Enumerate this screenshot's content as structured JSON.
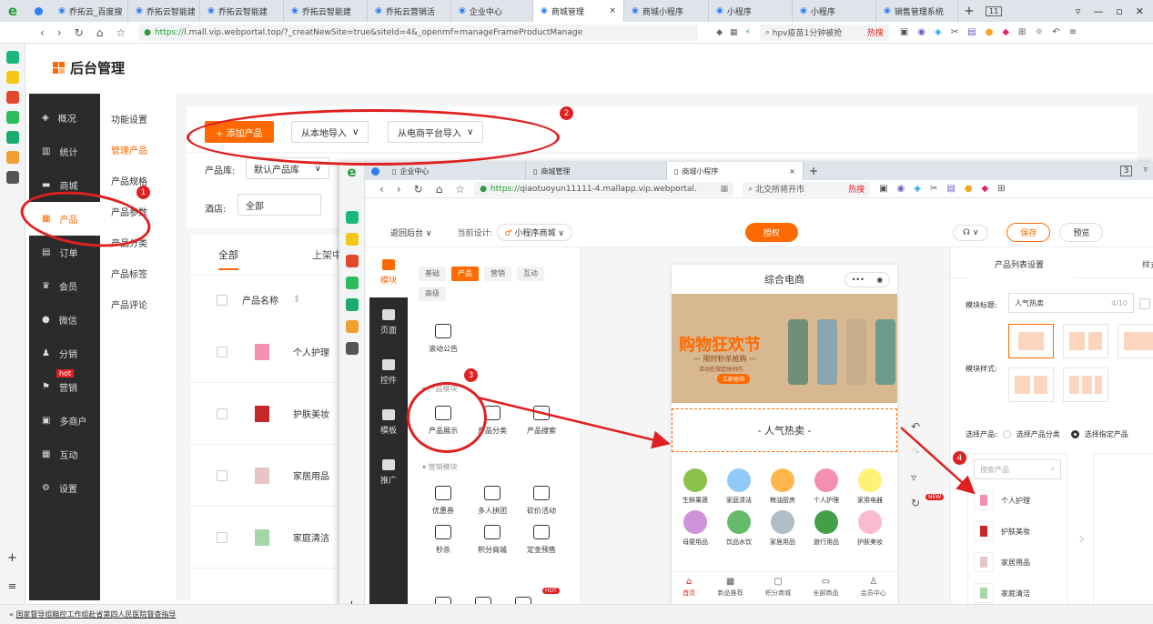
{
  "browser": {
    "tabs": [
      {
        "label": "乔拓云_百度搜"
      },
      {
        "label": "乔拓云智能建"
      },
      {
        "label": "乔拓云智能建"
      },
      {
        "label": "乔拓云智能建"
      },
      {
        "label": "乔拓云营销活"
      },
      {
        "label": "企业中心"
      },
      {
        "label": "商城管理",
        "active": true
      },
      {
        "label": "商城小程序"
      },
      {
        "label": "小程序"
      },
      {
        "label": "小程序"
      },
      {
        "label": "销售管理系统"
      }
    ],
    "tab_count": "11",
    "url_secure": "https://",
    "url": "l.mall.vip.webportal.top/?_creatNewSite=true&siteId=4&_openmf=manageFrameProductManage",
    "search_text": "hpv疫苗1分钟被抢",
    "hot_label": "热搜"
  },
  "app": {
    "title": "后台管理"
  },
  "sidebar": [
    {
      "label": "概况"
    },
    {
      "label": "统计"
    },
    {
      "label": "商城"
    },
    {
      "label": "产品",
      "active": true
    },
    {
      "label": "订单"
    },
    {
      "label": "会员"
    },
    {
      "label": "微信"
    },
    {
      "label": "分销"
    },
    {
      "label": "营销",
      "badge": "hot"
    },
    {
      "label": "多商户"
    },
    {
      "label": "互动"
    },
    {
      "label": "设置"
    }
  ],
  "submenu": [
    {
      "label": "功能设置"
    },
    {
      "label": "管理产品",
      "active": true
    },
    {
      "label": "产品规格"
    },
    {
      "label": "产品参数"
    },
    {
      "label": "产品分类"
    },
    {
      "label": "产品标签"
    },
    {
      "label": "产品评论"
    }
  ],
  "main": {
    "add_product": "+  添加产品",
    "import_local": "从本地导入",
    "import_ecom": "从电商平台导入",
    "lib_label": "产品库:",
    "lib_value": "默认产品库",
    "hotel_label": "酒店:",
    "hotel_value": "全部",
    "tab_all": "全部",
    "tab_onsale": "上架中",
    "col_name": "产品名称",
    "rows": [
      {
        "name": "个人护理"
      },
      {
        "name": "护肤美妆"
      },
      {
        "name": "家居用品"
      },
      {
        "name": "家庭清洁"
      }
    ]
  },
  "popup": {
    "tabs": [
      {
        "label": "企业中心"
      },
      {
        "label": "商城管理"
      },
      {
        "label": "商城小程序",
        "active": true
      }
    ],
    "url_secure": "https://",
    "url": "qiaotuoyun11111-4.mallapp.vip.webportal.",
    "search_text": "北交所将开市",
    "hot_label": "热搜",
    "tab_count": "3",
    "back_label": "返回后台",
    "current_design_label": "当前设计:",
    "current_design_value": "小程序商城",
    "authorize": "授权",
    "save": "保存",
    "preview": "预览",
    "vtabs": [
      {
        "label": "模块",
        "active": true
      },
      {
        "label": "页面"
      },
      {
        "label": "控件"
      },
      {
        "label": "模板"
      },
      {
        "label": "推广"
      }
    ],
    "widget_cats": [
      {
        "label": "基础"
      },
      {
        "label": "产品",
        "active": true
      },
      {
        "label": "营销"
      },
      {
        "label": "互动"
      },
      {
        "label": "高级"
      }
    ],
    "scroll_notice": "滚动公告",
    "product_module_title": "产品模块",
    "product_widgets": [
      {
        "label": "产品展示"
      },
      {
        "label": "产品分类"
      },
      {
        "label": "产品搜索"
      }
    ],
    "marketing_module_title": "营销模块",
    "marketing_widgets": [
      {
        "label": "优惠券"
      },
      {
        "label": "多人拼团"
      },
      {
        "label": "砍价活动"
      },
      {
        "label": "秒杀"
      },
      {
        "label": "积分商城"
      },
      {
        "label": "定金预售"
      }
    ],
    "hot_tag": "HOT",
    "new_tag": "NEW",
    "phone": {
      "title": "综合电商",
      "banner_title": "购物狂欢节",
      "banner_sub": "— 限时秒杀抢购 —",
      "banner_small": "活动在规定时间内",
      "banner_btn": "立即抢购",
      "section_title": "- 人气热卖 -",
      "categories": [
        {
          "label": "生鲜果蔬",
          "color": "#8bc34a"
        },
        {
          "label": "家庭清洁",
          "color": "#90caf9"
        },
        {
          "label": "粮油厨房",
          "color": "#ffb74d"
        },
        {
          "label": "个人护理",
          "color": "#f48fb1"
        },
        {
          "label": "家用电器",
          "color": "#fff176"
        },
        {
          "label": "母婴用品",
          "color": "#ce93d8"
        },
        {
          "label": "饮品水饮",
          "color": "#66bb6a"
        },
        {
          "label": "家居用品",
          "color": "#b0bec5"
        },
        {
          "label": "旅行用品",
          "color": "#43a047"
        },
        {
          "label": "护肤美妆",
          "color": "#f8bbd0"
        }
      ],
      "nav": [
        {
          "label": "首页",
          "active": true
        },
        {
          "label": "新品推荐"
        },
        {
          "label": "积分商城"
        },
        {
          "label": "全部商品"
        },
        {
          "label": "会员中心"
        }
      ]
    },
    "right": {
      "tab1": "产品列表设置",
      "tab2": "样式",
      "module_title_label": "模块标题:",
      "module_title_value": "人气热卖",
      "counter": "4/10",
      "style_label": "模块样式:",
      "select_label": "选择产品:",
      "opt_category": "选择产品分类",
      "opt_specific": "选择指定产品",
      "search_placeholder": "搜索产品",
      "products": [
        {
          "name": "个人护理"
        },
        {
          "name": "护肤美妆"
        },
        {
          "name": "家居用品"
        },
        {
          "name": "家庭清洁"
        }
      ]
    }
  },
  "annotations": [
    "1",
    "2",
    "3",
    "4"
  ],
  "status_bar": "国家督导组瞄控工作组赴省第四人民医院督查指导",
  "colors": {
    "accent": "#ff6a00",
    "annotation": "#e02020",
    "sidebar": "#2b2b2b"
  }
}
